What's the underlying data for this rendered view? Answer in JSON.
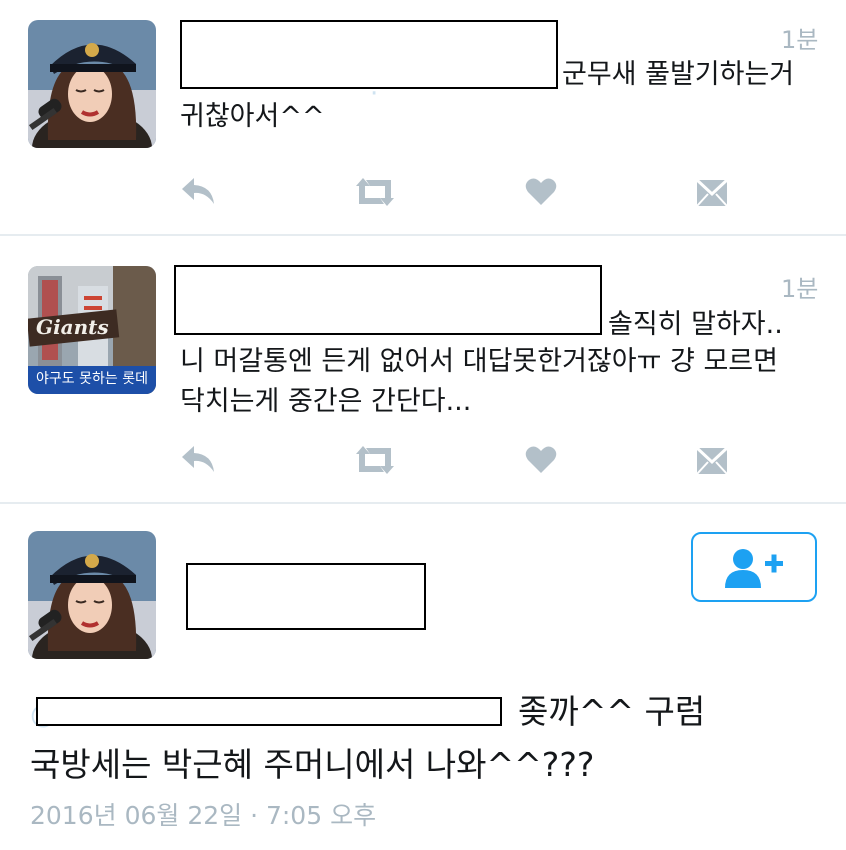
{
  "tweets": [
    {
      "time": "1분",
      "line1": "군무새 풀발기하는거",
      "line2": "귀찮아서^^"
    },
    {
      "time": "1분",
      "line1": "솔직히 말하자..",
      "line2": "니 머갈통엔 든게 없어서 대답못한거잖아ㅠ 걍 모르면",
      "line3": "닥치는게 중간은 간단다...",
      "avatar_text": "야구도 못하는 롯데",
      "avatar_logo": "Giants"
    }
  ],
  "detail": {
    "line1": "좆까^^ 구럼",
    "line2": "국방세는 박근혜 주머니에서 나와^^???",
    "timestamp": "2016년 06월 22일 · 7:05 오후"
  },
  "icons": {
    "reply": "reply-icon",
    "retweet": "retweet-icon",
    "like": "heart-icon",
    "dm": "envelope-icon",
    "follow": "follow-user-icon"
  },
  "colors": {
    "icon_gray": "#b3c0c9",
    "accent": "#1da1f2",
    "meta_gray": "#aab8c2"
  }
}
